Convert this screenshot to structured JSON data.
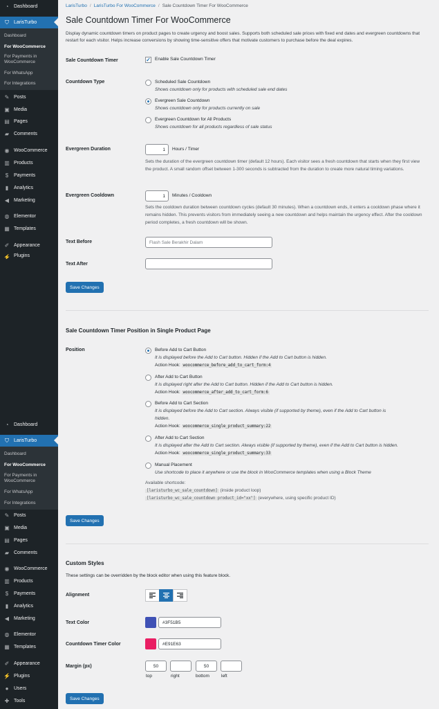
{
  "sidebar_top": {
    "dashboard": "Dashboard",
    "plugin": "LarisTurbo",
    "sub": [
      "Dashboard",
      "For WooCommerce",
      "For Payments in WooCommerce",
      "For WhatsApp",
      "For Integrations"
    ],
    "items": [
      "Posts",
      "Media",
      "Pages",
      "Comments",
      "WooCommerce",
      "Products",
      "Payments",
      "Analytics",
      "Marketing",
      "Elementor",
      "Templates",
      "Appearance",
      "Plugins"
    ]
  },
  "sidebar_bottom": {
    "dashboard": "Dashboard",
    "plugin": "LarisTurbo",
    "sub": [
      "Dashboard",
      "For WooCommerce",
      "For Payments in WooCommerce",
      "For WhatsApp",
      "For Integrations"
    ],
    "items": [
      "Posts",
      "Media",
      "Pages",
      "Comments",
      "WooCommerce",
      "Products",
      "Payments",
      "Analytics",
      "Marketing",
      "Elementor",
      "Templates",
      "Appearance",
      "Plugins",
      "Users",
      "Tools"
    ]
  },
  "breadcrumb": [
    "LarisTurbo",
    "LarisTurbo For WooCommerce",
    "Sale Countdown Timer For WooCommerce"
  ],
  "page_title": "Sale Countdown Timer For WooCommerce",
  "description": "Display dynamic countdown timers on product pages to create urgency and boost sales. Supports both scheduled sale prices with fixed end dates and evergreen countdowns that restart for each visitor. Helps increase conversions by showing time-sensitive offers that motivate customers to purchase before the deal expires.",
  "timer": {
    "label": "Sale Countdown Timer",
    "checkbox_label": "Enable Sale Countdown Timer",
    "enabled": true
  },
  "countdown_type": {
    "label": "Countdown Type",
    "options": [
      {
        "title": "Scheduled Sale Countdown",
        "desc": "Shows countdown only for products with scheduled sale end dates",
        "selected": false
      },
      {
        "title": "Evergreen Sale Countdown",
        "desc": "Shows countdown only for products currently on sale",
        "selected": true
      },
      {
        "title": "Evergreen Countdown for All Products",
        "desc": "Shows countdown for all products regardless of sale status",
        "selected": false
      }
    ]
  },
  "duration": {
    "label": "Evergreen Duration",
    "value": "1",
    "unit": "Hours / Timer",
    "help": "Sets the duration of the evergreen countdown timer (default 12 hours). Each visitor sees a fresh countdown that starts when they first view the product. A small random offset between 1-300 seconds is subtracted from the duration to create more natural timing variations."
  },
  "cooldown": {
    "label": "Evergreen Cooldown",
    "value": "1",
    "unit": "Minutes / Cooldown",
    "help": "Sets the cooldown duration between countdown cycles (default 30 minutes). When a countdown ends, it enters a cooldown phase where it remains hidden. This prevents visitors from immediately seeing a new countdown and helps maintain the urgency effect. After the cooldown period completes, a fresh countdown will be shown."
  },
  "text_before": {
    "label": "Text Before",
    "placeholder": "Flash Sale Berakhir Dalam"
  },
  "text_after": {
    "label": "Text After",
    "placeholder": ""
  },
  "save_label": "Save Changes",
  "position": {
    "heading": "Sale Countdown Timer Position in Single Product Page",
    "label": "Position",
    "hook_prefix": "Action Hook:",
    "options": [
      {
        "title": "Before Add to Cart Button",
        "desc": "It is displayed before the Add to Cart button. Hidden if the Add to Cart button is hidden.",
        "hook": "woocommerce_before_add_to_cart_form:4",
        "selected": true
      },
      {
        "title": "After Add to Cart Button",
        "desc": "It is displayed right after the Add to Cart button. Hidden if the Add to Cart button is hidden.",
        "hook": "woocommerce_after_add_to_cart_form:6",
        "selected": false
      },
      {
        "title": "Before Add to Cart Section",
        "desc_line1": "It is displayed before the Add to Cart section. Always visible (if supported by theme), even if the Add to Cart button is",
        "desc_line2": "hidden.",
        "hook": "woocommerce_single_product_summary:22",
        "selected": false
      },
      {
        "title": "After Add to Cart Section",
        "desc": "It is displayed after the Add to Cart section. Always visible (if supported by theme), even if the Add to Cart button is hidden.",
        "hook": "woocommerce_single_product_summary:33",
        "selected": false
      },
      {
        "title": "Manual Placement",
        "desc": "Use shortcode to place it anywhere or use the block in WooCommerce templates when using a Block Theme",
        "selected": false
      }
    ],
    "shortcode_label": "Available shortcode:",
    "shortcode1": "[laristurbo_wc_sale_countdown]",
    "shortcode1_note": "(inside product loop)",
    "shortcode2": "[laristurbo_wc_sale_countdown product_id=\"xx\"]",
    "shortcode2_note": "(everywhere, using specific product ID)"
  },
  "styles": {
    "heading": "Custom Styles",
    "note": "These settings can be overridden by the block editor when using this feature block.",
    "alignment_label": "Alignment",
    "alignment_selected": "center",
    "text_color_label": "Text Color",
    "text_color": "#3F51B5",
    "timer_color_label": "Countdown Timer Color",
    "timer_color": "#E91E63",
    "margin_label": "Margin (px)",
    "margin": {
      "top": "50",
      "right": "",
      "bottom": "50",
      "left": ""
    },
    "margin_labels": [
      "top",
      "right",
      "bottom",
      "left"
    ]
  },
  "colors": {
    "accent": "#2271b1",
    "sidebar_bg": "#1d2327",
    "submenu_bg": "#2c3338"
  }
}
